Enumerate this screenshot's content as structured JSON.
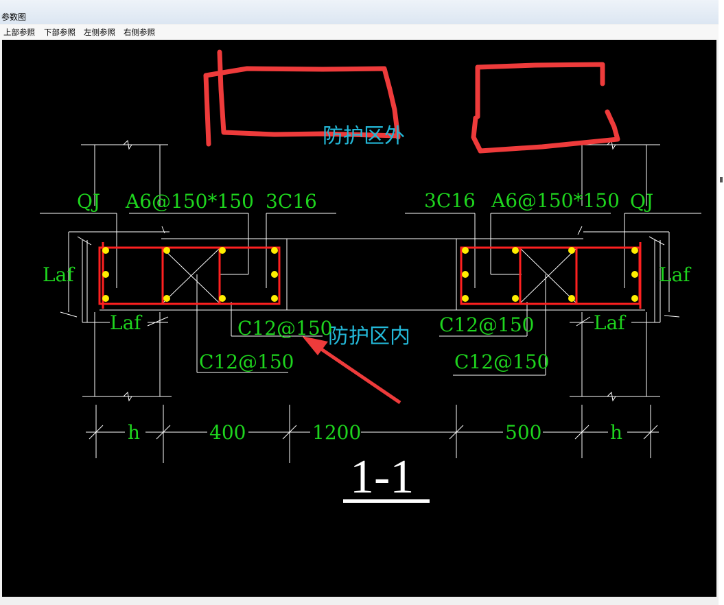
{
  "window": {
    "title": "参数图"
  },
  "menu": {
    "items": [
      {
        "label": "上部参照"
      },
      {
        "label": "下部参照"
      },
      {
        "label": "左侧参照"
      },
      {
        "label": "右侧参照"
      }
    ]
  },
  "drawing": {
    "zone_outside": "防护区外",
    "zone_inside": "防护区内",
    "left": {
      "qj": "QJ",
      "stirrup": "A6@150*150",
      "bars": "3C16",
      "laf_vertical": "Laf",
      "laf_horizontal": "Laf",
      "tie_upper": "C12@150",
      "tie_lower": "C12@150"
    },
    "right": {
      "qj": "QJ",
      "stirrup": "A6@150*150",
      "bars": "3C16",
      "laf_vertical": "Laf",
      "laf_horizontal": "Laf",
      "tie_upper": "C12@150",
      "tie_lower": "C12@150"
    },
    "dimensions": {
      "h_left": "h",
      "d400": "400",
      "d1200": "1200",
      "d500": "500",
      "h_right": "h"
    },
    "section_label": "1-1"
  },
  "colors": {
    "background": "#000000",
    "text_green": "#1ed51e",
    "text_cyan": "#23b8d8",
    "rebar_red": "#ff2020",
    "bar_yellow": "#ffee00",
    "annotation_red": "#ee3b3b"
  }
}
